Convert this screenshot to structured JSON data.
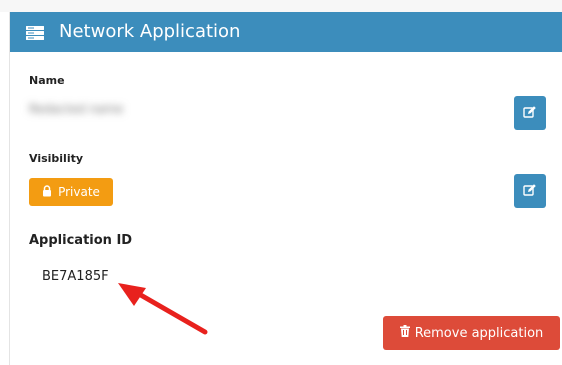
{
  "header": {
    "title": "Network Application",
    "icon": "server-icon",
    "background": "#3c8dbc"
  },
  "name_field": {
    "label": "Name",
    "value_obscured": "Redacted name",
    "edit_icon": "edit-icon"
  },
  "visibility_field": {
    "label": "Visibility",
    "value": "Private",
    "badge_icon": "lock-icon",
    "badge_color": "#f39c12",
    "edit_icon": "edit-icon"
  },
  "application_id": {
    "label": "Application ID",
    "value": "BE7A185F"
  },
  "actions": {
    "remove_label": "Remove application",
    "remove_icon": "trash-icon",
    "remove_color": "#dd4b39"
  },
  "annotation": {
    "arrow_color": "#e8211d"
  }
}
